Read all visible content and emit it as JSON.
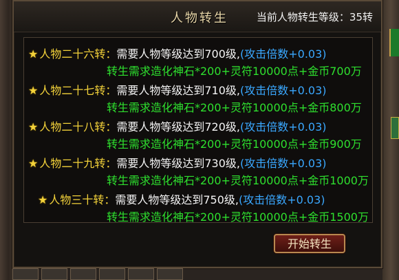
{
  "header": {
    "title": "人物转生",
    "level_text": "当前人物转生等级：35转"
  },
  "rows": [
    {
      "name": "人物二十六转：",
      "requirement": "需要人物等级达到700级,",
      "bonus": "(攻击倍数+0.03)",
      "cost": "转生需求造化神石*200+灵符10000点+金币700万"
    },
    {
      "name": "人物二十七转：",
      "requirement": "需要人物等级达到710级,",
      "bonus": "(攻击倍数+0.03)",
      "cost": "转生需求造化神石*200+灵符10000点+金币800万"
    },
    {
      "name": "人物二十八转：",
      "requirement": "需要人物等级达到720级,",
      "bonus": "(攻击倍数+0.03)",
      "cost": "转生需求造化神石*200+灵符10000点+金币900万"
    },
    {
      "name": "人物二十九转：",
      "requirement": "需要人物等级达到730级,",
      "bonus": "(攻击倍数+0.03)",
      "cost": "转生需求造化神石*200+灵符10000点+金币1000万"
    },
    {
      "name": "人物三十转：",
      "requirement": "需要人物等级达到750级,",
      "bonus": "(攻击倍数+0.03)",
      "cost": "转生需求造化神石*200+灵符10000点+金币1500万"
    }
  ],
  "actions": {
    "start_label": "开始转生"
  },
  "icons": {
    "row_icon": "star-icon"
  },
  "colors": {
    "name": "#f3d23a",
    "requirement": "#f4f4f4",
    "bonus": "#3aa8ff",
    "cost": "#2ee02e"
  }
}
